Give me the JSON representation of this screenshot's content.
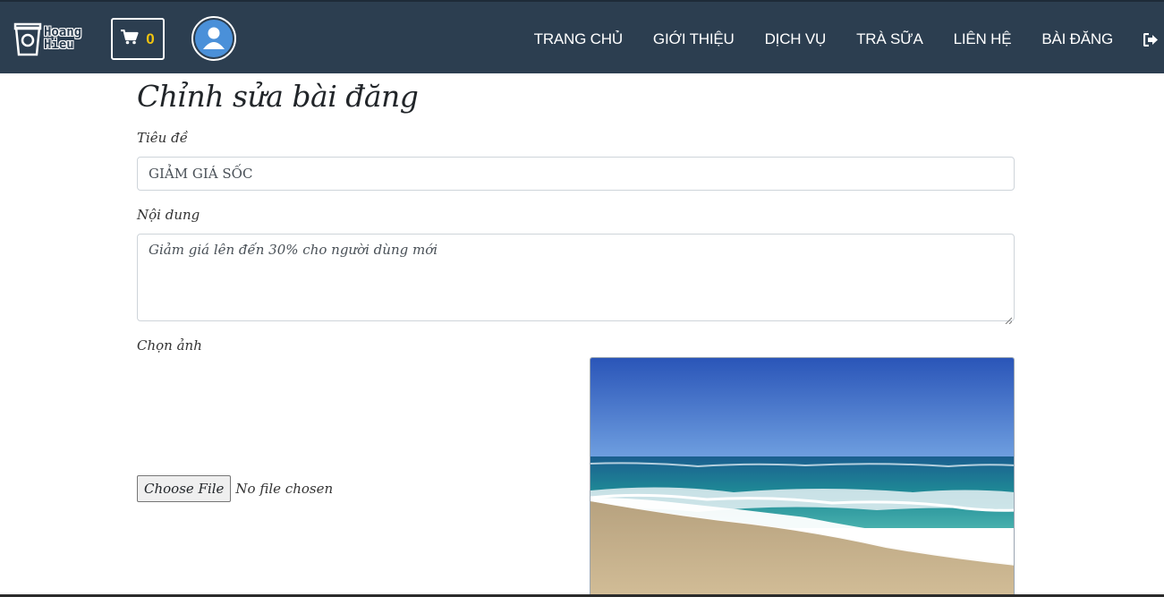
{
  "header": {
    "logo_text_line1": "Hoang",
    "logo_text_line2": "Hieu",
    "cart_count": "0",
    "nav_items": [
      "TRANG CHỦ",
      "GIỚI THIỆU",
      "DỊCH VỤ",
      "TRÀ SỮA",
      "LIÊN HỆ",
      "BÀI ĐĂNG"
    ],
    "icons": [
      "cup-logo-icon",
      "cart-icon",
      "user-avatar-icon",
      "logout-icon"
    ]
  },
  "form": {
    "title": "Chỉnh sửa bài đăng",
    "title_label": "Tiêu đề",
    "title_value": "GIẢM GIÁ SỐC",
    "content_label": "Nội dung",
    "content_value": "Giảm giá lên đến 30% cho người dùng mới",
    "image_label": "Chọn ảnh",
    "file_button": "Choose File",
    "file_status": "No file chosen"
  },
  "colors": {
    "navbar": "#2c3e50",
    "cart_count": "#f1c40f",
    "avatar": "#4a90d9"
  }
}
